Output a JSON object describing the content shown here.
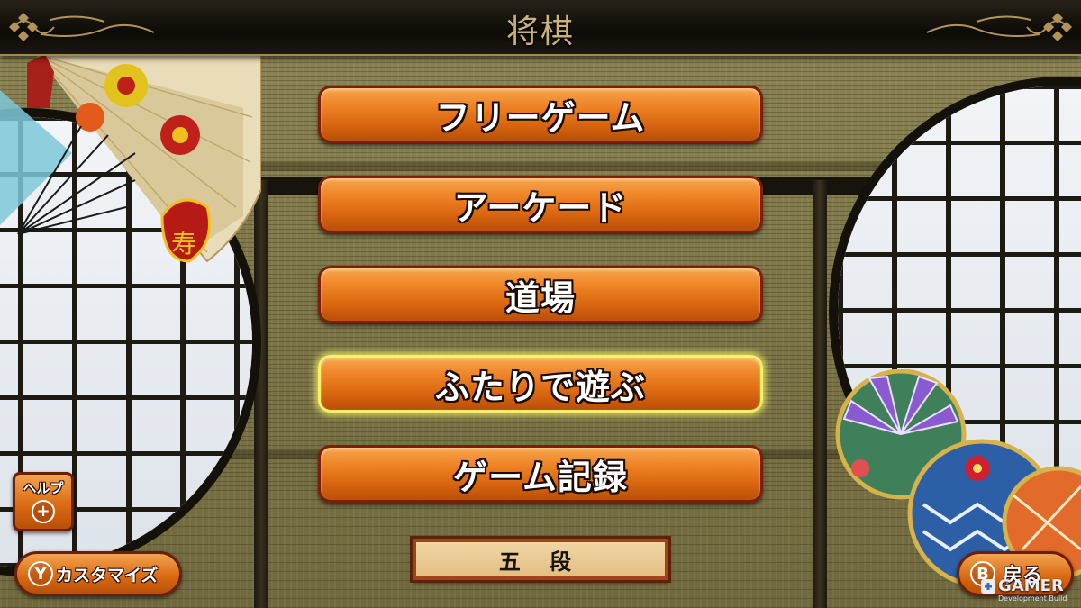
{
  "header": {
    "title": "将棋"
  },
  "menu": {
    "items": [
      {
        "label": "フリーゲーム",
        "selected": false
      },
      {
        "label": "アーケード",
        "selected": false
      },
      {
        "label": "道場",
        "selected": false
      },
      {
        "label": "ふたりで遊ぶ",
        "selected": true
      },
      {
        "label": "ゲーム記録",
        "selected": false
      }
    ]
  },
  "rank": {
    "text": "五 段"
  },
  "help": {
    "label": "ヘルプ",
    "button_glyph": "+",
    "icon": "plus-icon"
  },
  "customize": {
    "button_glyph": "Y",
    "label": "カスタマイズ"
  },
  "back": {
    "button_glyph": "B",
    "label": "戻る"
  },
  "watermark": {
    "brand": "GAMER",
    "sub": "Development Build"
  },
  "colors": {
    "button_orange": "#ee8224",
    "button_border": "#7a1f08",
    "selected_glow": "#f6f06a",
    "title_gold": "#cbb27a",
    "title_bar": "#0d0b07"
  }
}
